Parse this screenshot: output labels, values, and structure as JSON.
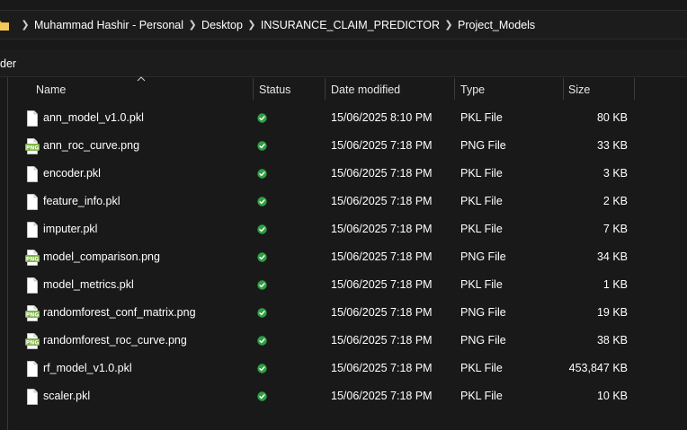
{
  "breadcrumb": [
    "Muhammad Hashir - Personal",
    "Desktop",
    "INSURANCE_CLAIM_PREDICTOR",
    "Project_Models"
  ],
  "toolbar": {
    "label": "der"
  },
  "columns": {
    "name": "Name",
    "status": "Status",
    "date": "Date modified",
    "type": "Type",
    "size": "Size"
  },
  "files": [
    {
      "name": "ann_model_v1.0.pkl",
      "date": "15/06/2025 8:10 PM",
      "type": "PKL File",
      "size": "80 KB",
      "icon": "pkl-file-icon"
    },
    {
      "name": "ann_roc_curve.png",
      "date": "15/06/2025 7:18 PM",
      "type": "PNG File",
      "size": "33 KB",
      "icon": "png-file-icon"
    },
    {
      "name": "encoder.pkl",
      "date": "15/06/2025 7:18 PM",
      "type": "PKL File",
      "size": "3 KB",
      "icon": "pkl-file-icon"
    },
    {
      "name": "feature_info.pkl",
      "date": "15/06/2025 7:18 PM",
      "type": "PKL File",
      "size": "2 KB",
      "icon": "pkl-file-icon"
    },
    {
      "name": "imputer.pkl",
      "date": "15/06/2025 7:18 PM",
      "type": "PKL File",
      "size": "7 KB",
      "icon": "pkl-file-icon"
    },
    {
      "name": "model_comparison.png",
      "date": "15/06/2025 7:18 PM",
      "type": "PNG File",
      "size": "34 KB",
      "icon": "png-file-icon"
    },
    {
      "name": "model_metrics.pkl",
      "date": "15/06/2025 7:18 PM",
      "type": "PKL File",
      "size": "1 KB",
      "icon": "pkl-file-icon"
    },
    {
      "name": "randomforest_conf_matrix.png",
      "date": "15/06/2025 7:18 PM",
      "type": "PNG File",
      "size": "19 KB",
      "icon": "png-file-icon"
    },
    {
      "name": "randomforest_roc_curve.png",
      "date": "15/06/2025 7:18 PM",
      "type": "PNG File",
      "size": "38 KB",
      "icon": "png-file-icon"
    },
    {
      "name": "rf_model_v1.0.pkl",
      "date": "15/06/2025 7:18 PM",
      "type": "PKL File",
      "size": "453,847 KB",
      "icon": "pkl-file-icon"
    },
    {
      "name": "scaler.pkl",
      "date": "15/06/2025 7:18 PM",
      "type": "PKL File",
      "size": "10 KB",
      "icon": "pkl-file-icon"
    }
  ],
  "colors": {
    "background": "#191919",
    "status_green": "#2ea043",
    "png_icon_green": "#7fb34a"
  }
}
